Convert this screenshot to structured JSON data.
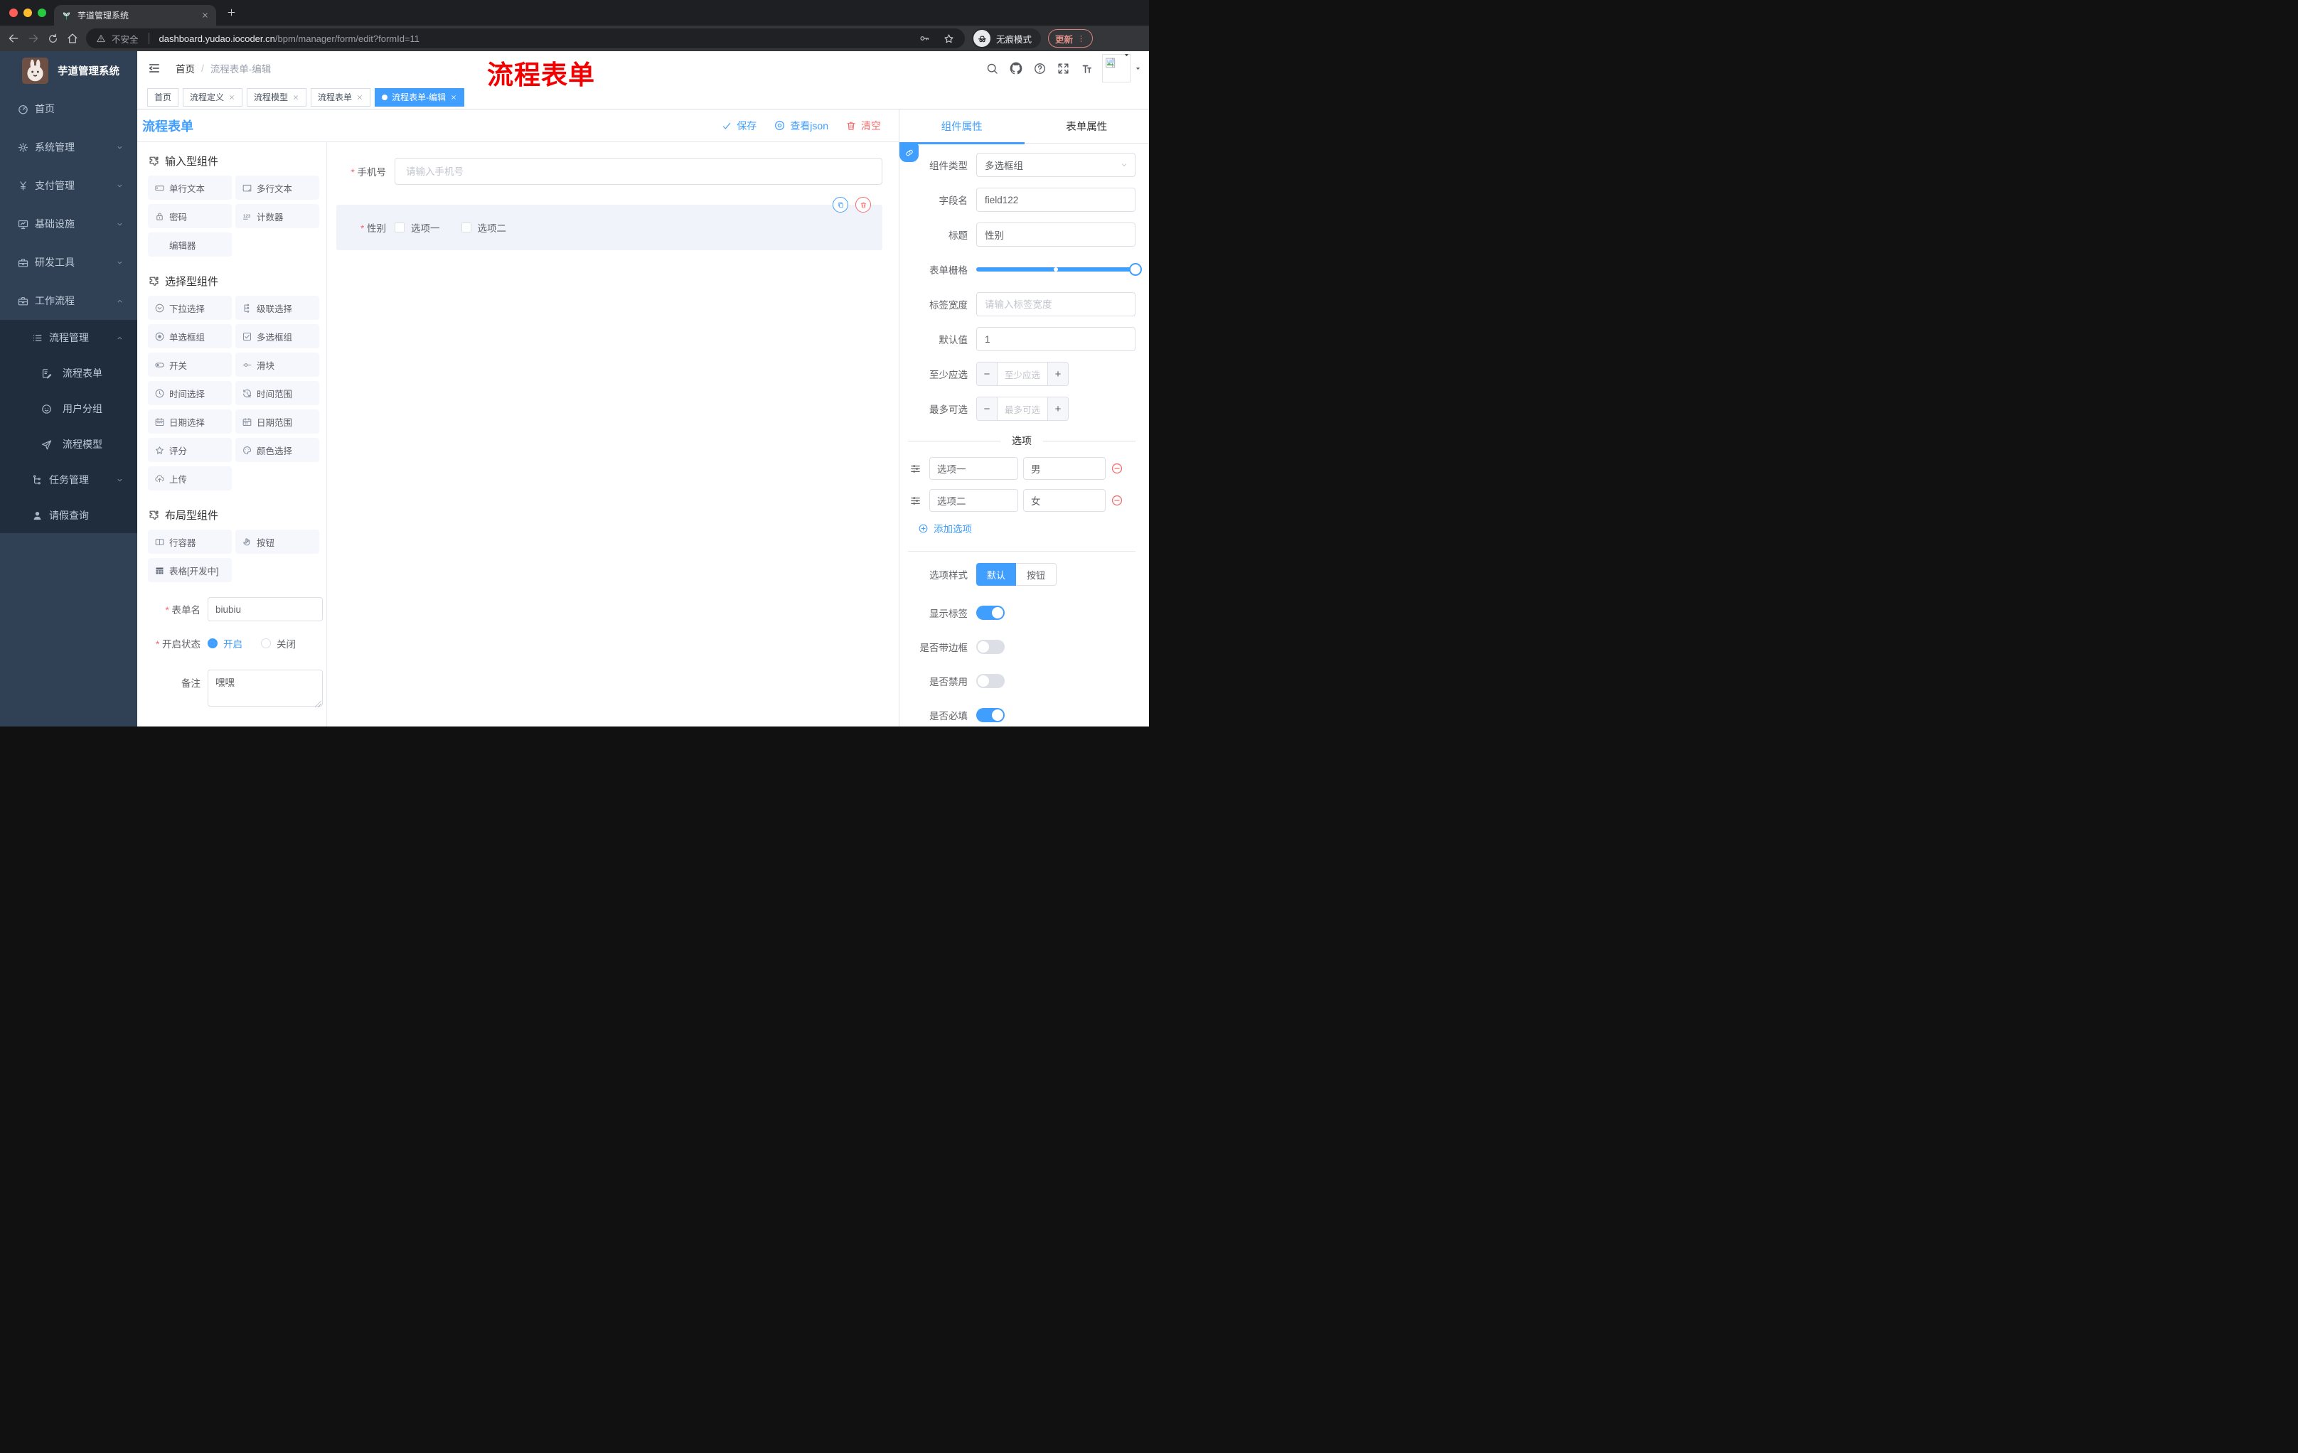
{
  "colors": {
    "primary": "#409EFF",
    "danger": "#F56C6C",
    "sidebar": "#304156",
    "sidebar_sub": "#1F2D3D",
    "annotation": "#F50000"
  },
  "browser": {
    "tab_title": "芋道管理系统",
    "security_label": "不安全",
    "url_host": "dashboard.yudao.iocoder.cn",
    "url_path": "/bpm/manager/form/edit?formId=11",
    "incognito_label": "无痕模式",
    "update_label": "更新"
  },
  "sidebar": {
    "logo_title": "芋道管理系统",
    "items": [
      {
        "label": "首页",
        "icon": "dashboard-icon"
      },
      {
        "label": "系统管理",
        "icon": "gear-icon",
        "chevron": "down"
      },
      {
        "label": "支付管理",
        "icon": "yen-icon",
        "chevron": "down"
      },
      {
        "label": "基础设施",
        "icon": "monitor-icon",
        "chevron": "down"
      },
      {
        "label": "研发工具",
        "icon": "toolbox-icon",
        "chevron": "down"
      },
      {
        "label": "工作流程",
        "icon": "briefcase-icon",
        "chevron": "up"
      },
      {
        "label": "流程管理",
        "icon": "list-icon",
        "chevron": "up"
      },
      {
        "label": "流程表单",
        "icon": "form-edit-icon"
      },
      {
        "label": "用户分组",
        "icon": "user-group-icon"
      },
      {
        "label": "流程模型",
        "icon": "paper-plane-icon"
      },
      {
        "label": "任务管理",
        "icon": "tree-icon",
        "chevron": "down"
      },
      {
        "label": "请假查询",
        "icon": "person-icon"
      }
    ]
  },
  "header": {
    "breadcrumb_home": "首页",
    "breadcrumb_sep": "/",
    "breadcrumb_current": "流程表单-编辑",
    "annotation": "流程表单"
  },
  "tagsview": [
    {
      "label": "首页",
      "closable": false,
      "active": false
    },
    {
      "label": "流程定义",
      "closable": true,
      "active": false
    },
    {
      "label": "流程模型",
      "closable": true,
      "active": false
    },
    {
      "label": "流程表单",
      "closable": true,
      "active": false
    },
    {
      "label": "流程表单-编辑",
      "closable": true,
      "active": true
    }
  ],
  "designer": {
    "title": "流程表单",
    "save_label": "保存",
    "view_json_label": "查看json",
    "clear_label": "清空"
  },
  "palette": {
    "sections": [
      {
        "title": "输入型组件",
        "items": [
          {
            "label": "单行文本",
            "icon": "input-icon"
          },
          {
            "label": "多行文本",
            "icon": "textarea-icon"
          },
          {
            "label": "密码",
            "icon": "lock-icon"
          },
          {
            "label": "计数器",
            "icon": "counter-icon"
          },
          {
            "label": "编辑器",
            "icon": ""
          }
        ]
      },
      {
        "title": "选择型组件",
        "items": [
          {
            "label": "下拉选择",
            "icon": "select-icon"
          },
          {
            "label": "级联选择",
            "icon": "cascader-icon"
          },
          {
            "label": "单选框组",
            "icon": "radio-icon"
          },
          {
            "label": "多选框组",
            "icon": "checkbox-icon"
          },
          {
            "label": "开关",
            "icon": "switch-icon"
          },
          {
            "label": "滑块",
            "icon": "slider-icon"
          },
          {
            "label": "时间选择",
            "icon": "time-icon"
          },
          {
            "label": "时间范围",
            "icon": "time-range-icon"
          },
          {
            "label": "日期选择",
            "icon": "date-icon"
          },
          {
            "label": "日期范围",
            "icon": "date-range-icon"
          },
          {
            "label": "评分",
            "icon": "star-icon"
          },
          {
            "label": "颜色选择",
            "icon": "palette-icon"
          },
          {
            "label": "上传",
            "icon": "upload-icon"
          }
        ]
      },
      {
        "title": "布局型组件",
        "items": [
          {
            "label": "行容器",
            "icon": "row-icon"
          },
          {
            "label": "按钮",
            "icon": "hand-icon"
          },
          {
            "label": "表格[开发中]",
            "icon": "table-icon"
          }
        ]
      }
    ],
    "form": {
      "name_label": "表单名",
      "name_value": "biubiu",
      "status_label": "开启状态",
      "status_on": "开启",
      "status_off": "关闭",
      "remark_label": "备注",
      "remark_value": "嘿嘿"
    }
  },
  "canvas": {
    "phone_label": "手机号",
    "phone_placeholder": "请输入手机号",
    "gender_label": "性别",
    "gender_option1": "选项一",
    "gender_option2": "选项二"
  },
  "inspector": {
    "tab_component": "组件属性",
    "tab_form": "表单属性",
    "component_type_label": "组件类型",
    "component_type_value": "多选框组",
    "field_name_label": "字段名",
    "field_name_value": "field122",
    "title_label": "标题",
    "title_value": "性别",
    "grid_label": "表单栅格",
    "label_width_label": "标签宽度",
    "label_width_placeholder": "请输入标签宽度",
    "default_label": "默认值",
    "default_value": "1",
    "min_label": "至少应选",
    "min_placeholder": "至少应选",
    "max_label": "最多可选",
    "max_placeholder": "最多可选",
    "options_title": "选项",
    "options": [
      {
        "label": "选项一",
        "value": "男"
      },
      {
        "label": "选项二",
        "value": "女"
      }
    ],
    "add_option_label": "添加选项",
    "style_label": "选项样式",
    "style_default": "默认",
    "style_button": "按钮",
    "switch_show_label": "显示标签",
    "switch_border_label": "是否带边框",
    "switch_disabled_label": "是否禁用",
    "switch_required_label": "是否必填"
  }
}
